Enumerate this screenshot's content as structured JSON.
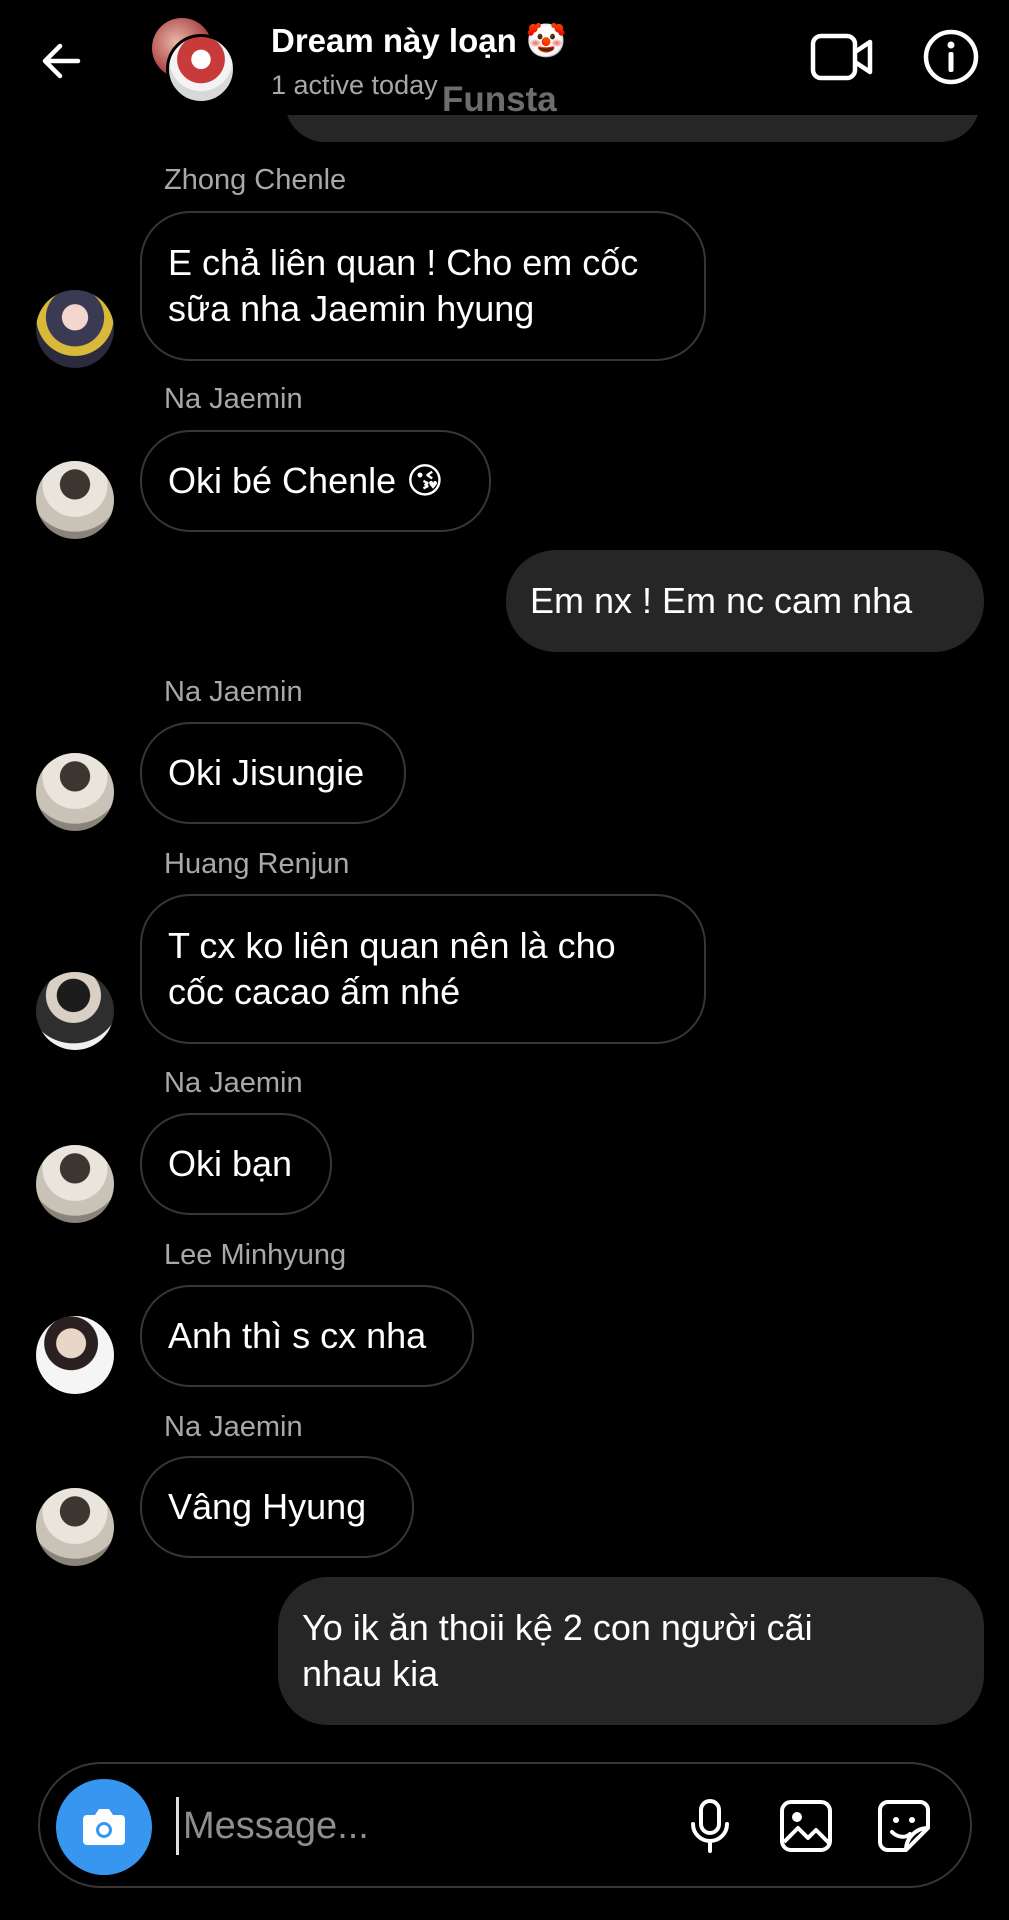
{
  "header": {
    "title": "Dream này loạn 🤡",
    "subtitle": "1 active today",
    "watermark": "Funsta"
  },
  "messages": [
    {
      "sender": "Zhong Chenle",
      "lines": [
        "E chả liên quan ! Cho em cốc",
        "sữa nha Jaemin hyung"
      ]
    },
    {
      "sender": "Na Jaemin",
      "text": "Oki bé Chenle 😘"
    },
    {
      "outgoing": true,
      "text": "Em nx ! Em nc cam nha"
    },
    {
      "sender": "Na Jaemin",
      "text": "Oki Jisungie"
    },
    {
      "sender": "Huang Renjun",
      "lines": [
        "T cx ko liên quan nên là cho",
        "cốc cacao ấm nhé"
      ]
    },
    {
      "sender": "Na Jaemin",
      "text": "Oki bạn"
    },
    {
      "sender": "Lee Minhyung",
      "text": "Anh thì s cx nha"
    },
    {
      "sender": "Na Jaemin",
      "text": "Vâng Hyung"
    },
    {
      "outgoing": true,
      "lines": [
        "Yo ik ăn thoii kệ 2 con người cãi",
        "nhau kia"
      ]
    }
  ],
  "composer": {
    "placeholder": "Message..."
  },
  "colors": {
    "background": "#000000",
    "incoming_border": "#363636",
    "outgoing_bubble": "#262626",
    "camera_button": "#3797f0",
    "secondary_text": "#a8a8a8"
  }
}
